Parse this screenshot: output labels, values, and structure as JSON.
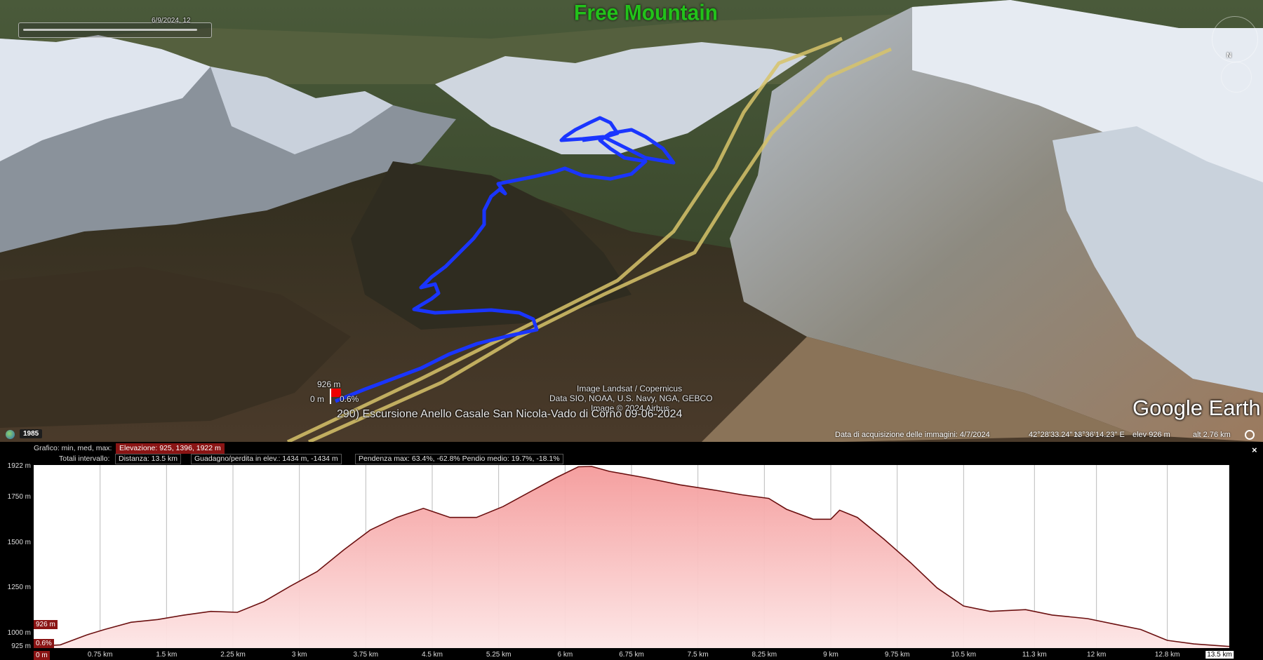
{
  "map": {
    "timeline_date": "6/9/2024, 12",
    "watermark": "Free Mountain",
    "attribution_lines": [
      "Image Landsat / Copernicus",
      "Data SIO, NOAA, U.S. Navy, NGA, GEBCO",
      "Image © 2024 Airbus"
    ],
    "track_title": "290) Escursione Anello Casale San Nicola-Vado di Corno 09-06-2024",
    "marker_elev": "926 m",
    "marker_dist": "0 m",
    "marker_slope": "0.6%",
    "logo_text": "Google Earth",
    "compass_north": "N",
    "year": "1985",
    "status": {
      "acq_date": "Data di acquisizione delle immagini: 4/7/2024",
      "lat": "42°28'33.24\" N",
      "lon": "13°36'14.23\" E",
      "elev": "elev  926 m",
      "alt": "alt  2.76 km"
    },
    "colors": {
      "track": "#1a35ff",
      "trails": "#d7c36a",
      "watermark": "#22c21a"
    }
  },
  "profile": {
    "stats_label_1": "Grafico: min, med, max:",
    "elevation_stat": "Elevazione: 925, 1396, 1922 m",
    "stats_label_2": "Totali intervallo:",
    "distance_stat": "Distanza: 13.5 km",
    "gain_stat": "Guadagno/perdita in elev.: 1434 m, -1434 m",
    "slope_stat": "Pendenza max: 63.4%, -62.8%  Pendio medio: 19.7%, -18.1%",
    "close_label": "×",
    "cursor_elev": "926 m",
    "cursor_slope": "0.6%",
    "cursor_dist": "0 m",
    "colors": {
      "fill": "#f7b8b8",
      "line": "#6b1010",
      "tag": "#8a1414"
    }
  },
  "chart_data": {
    "type": "area",
    "xlabel": "",
    "ylabel": "",
    "xlim": [
      0,
      13.5
    ],
    "ylim": [
      925,
      1922
    ],
    "y_ticks": [
      {
        "label": "1922 m",
        "value": 1922
      },
      {
        "label": "1750 m",
        "value": 1750
      },
      {
        "label": "1500 m",
        "value": 1500
      },
      {
        "label": "1250 m",
        "value": 1250
      },
      {
        "label": "1000 m",
        "value": 1000
      },
      {
        "label": "925 m",
        "value": 925
      }
    ],
    "x_ticks": [
      {
        "label": "0.75 km",
        "value": 0.75
      },
      {
        "label": "1.5 km",
        "value": 1.5
      },
      {
        "label": "2.25 km",
        "value": 2.25
      },
      {
        "label": "3 km",
        "value": 3
      },
      {
        "label": "3.75 km",
        "value": 3.75
      },
      {
        "label": "4.5 km",
        "value": 4.5
      },
      {
        "label": "5.25 km",
        "value": 5.25
      },
      {
        "label": "6 km",
        "value": 6
      },
      {
        "label": "6.75 km",
        "value": 6.75
      },
      {
        "label": "7.5 km",
        "value": 7.5
      },
      {
        "label": "8.25 km",
        "value": 8.25
      },
      {
        "label": "9 km",
        "value": 9
      },
      {
        "label": "9.75 km",
        "value": 9.75
      },
      {
        "label": "10.5 km",
        "value": 10.5
      },
      {
        "label": "11.3 km",
        "value": 11.3
      },
      {
        "label": "12 km",
        "value": 12
      },
      {
        "label": "12.8 km",
        "value": 12.8
      },
      {
        "label": "13.5 km",
        "value": 13.5
      }
    ],
    "x": [
      0,
      0.3,
      0.6,
      0.8,
      1.1,
      1.4,
      1.7,
      2.0,
      2.3,
      2.6,
      2.9,
      3.2,
      3.5,
      3.8,
      4.1,
      4.4,
      4.55,
      4.7,
      5.0,
      5.3,
      5.6,
      5.9,
      6.15,
      6.3,
      6.5,
      6.9,
      7.3,
      7.7,
      8.0,
      8.3,
      8.5,
      8.8,
      9.0,
      9.1,
      9.3,
      9.6,
      9.9,
      10.2,
      10.5,
      10.8,
      11.2,
      11.5,
      11.9,
      12.2,
      12.5,
      12.8,
      13.1,
      13.5
    ],
    "series": [
      {
        "values": [
          926,
          935,
          990,
          1020,
          1060,
          1075,
          1100,
          1120,
          1115,
          1175,
          1260,
          1340,
          1460,
          1570,
          1640,
          1690,
          1665,
          1640,
          1640,
          1700,
          1780,
          1860,
          1920,
          1922,
          1895,
          1860,
          1820,
          1790,
          1765,
          1745,
          1685,
          1630,
          1630,
          1680,
          1640,
          1520,
          1390,
          1250,
          1150,
          1120,
          1130,
          1100,
          1080,
          1050,
          1020,
          960,
          940,
          926
        ]
      }
    ]
  }
}
